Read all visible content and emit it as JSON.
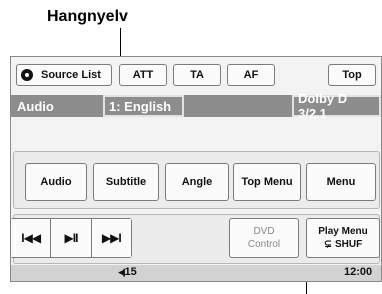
{
  "callouts": {
    "top_label": "Hangnyelv"
  },
  "toolbar": {
    "source_list": "Source List",
    "att": "ATT",
    "ta": "TA",
    "af": "AF",
    "top": "Top"
  },
  "info_bar": {
    "source": "Audio",
    "language": "1: English",
    "audio_format": "Dolby D 3/2.1"
  },
  "menu_buttons": {
    "audio": "Audio",
    "subtitle": "Subtitle",
    "angle": "Angle",
    "top_menu": "Top Menu",
    "menu": "Menu"
  },
  "playback": {
    "prev_icon": "I◀◀",
    "play_pause_icon": "▶II",
    "next_icon": "▶▶I",
    "dvd_control_line1": "DVD",
    "dvd_control_line2": "Control",
    "play_menu_line1": "Play Menu",
    "play_menu_line2": "⊊ SHUF"
  },
  "status_bar": {
    "volume": "15",
    "volume_icon": "◀|",
    "clock": "12:00"
  }
}
